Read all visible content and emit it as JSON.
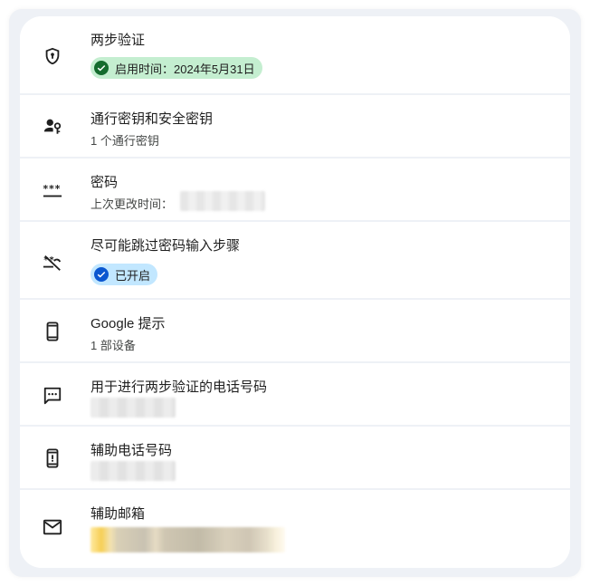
{
  "rows": [
    {
      "icon": "shield-lock-icon",
      "title": "两步验证",
      "chip": {
        "text": "启用时间：2024年5月31日",
        "color": "#146c2e",
        "background": "#c4eed0"
      }
    },
    {
      "icon": "passkey-icon",
      "title": "通行密钥和安全密钥",
      "subtitle": "1 个通行密钥"
    },
    {
      "icon": "password-dots-icon",
      "title": "密码",
      "subtitle": "上次更改时间："
    },
    {
      "icon": "skip-password-icon",
      "title": "尽可能跳过密码输入步骤",
      "chip": {
        "text": "已开启",
        "color": "#0b57d0",
        "background": "#c2e7ff"
      }
    },
    {
      "icon": "phone-icon",
      "title": "Google 提示",
      "subtitle": "1 部设备"
    },
    {
      "icon": "sms-icon",
      "title": "用于进行两步验证的电话号码"
    },
    {
      "icon": "phone-alert-icon",
      "title": "辅助电话号码"
    },
    {
      "icon": "mail-icon",
      "title": "辅助邮箱"
    }
  ]
}
